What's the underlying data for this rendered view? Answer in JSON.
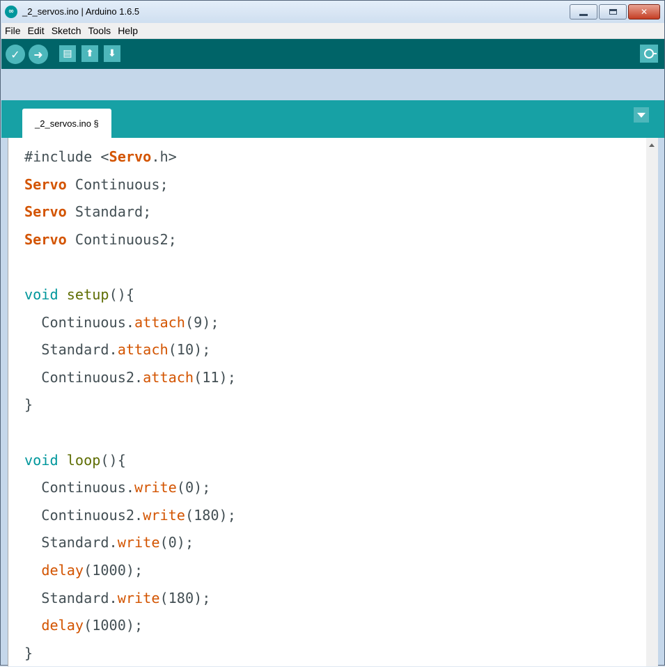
{
  "window": {
    "title": "_2_servos.ino | Arduino 1.6.5",
    "icon": "arduino-logo-icon"
  },
  "menubar": {
    "items": [
      "File",
      "Edit",
      "Sketch",
      "Tools",
      "Help"
    ]
  },
  "toolbar": {
    "buttons": [
      "verify-icon",
      "upload-icon",
      "new-icon",
      "open-icon",
      "save-icon"
    ],
    "serial_monitor_icon": "serial-monitor-icon"
  },
  "tabs": [
    {
      "label": "_2_servos.ino §"
    }
  ],
  "colors": {
    "toolbar_bg": "#006468",
    "tabstrip_bg": "#17a1a5",
    "button_bg": "#4db7bb",
    "keyword_type": "#d35400",
    "keyword_void": "#00979c",
    "function_setup": "#5e6d03",
    "function_call": "#d35400",
    "plain_text": "#434f54"
  },
  "code": {
    "lines": [
      [
        {
          "t": "#include <"
        },
        {
          "t": "Servo",
          "c": "kw-type"
        },
        {
          "t": ".h>"
        }
      ],
      [
        {
          "t": "Servo",
          "c": "kw-type"
        },
        {
          "t": " Continuous;"
        }
      ],
      [
        {
          "t": "Servo",
          "c": "kw-type"
        },
        {
          "t": " Standard;"
        }
      ],
      [
        {
          "t": "Servo",
          "c": "kw-type"
        },
        {
          "t": " Continuous2;"
        }
      ],
      [],
      [
        {
          "t": "void",
          "c": "kw-void"
        },
        {
          "t": " "
        },
        {
          "t": "setup",
          "c": "fn-setup"
        },
        {
          "t": "(){"
        }
      ],
      [
        {
          "t": "  Continuous."
        },
        {
          "t": "attach",
          "c": "fn-call"
        },
        {
          "t": "(9);"
        }
      ],
      [
        {
          "t": "  Standard."
        },
        {
          "t": "attach",
          "c": "fn-call"
        },
        {
          "t": "(10);"
        }
      ],
      [
        {
          "t": "  Continuous2."
        },
        {
          "t": "attach",
          "c": "fn-call"
        },
        {
          "t": "(11);"
        }
      ],
      [
        {
          "t": "}"
        }
      ],
      [],
      [
        {
          "t": "void",
          "c": "kw-void"
        },
        {
          "t": " "
        },
        {
          "t": "loop",
          "c": "fn-setup"
        },
        {
          "t": "(){"
        }
      ],
      [
        {
          "t": "  Continuous."
        },
        {
          "t": "write",
          "c": "fn-call"
        },
        {
          "t": "(0);"
        }
      ],
      [
        {
          "t": "  Continuous2."
        },
        {
          "t": "write",
          "c": "fn-call"
        },
        {
          "t": "(180);"
        }
      ],
      [
        {
          "t": "  Standard."
        },
        {
          "t": "write",
          "c": "fn-call"
        },
        {
          "t": "(0);"
        }
      ],
      [
        {
          "t": "  "
        },
        {
          "t": "delay",
          "c": "fn-call"
        },
        {
          "t": "(1000);"
        }
      ],
      [
        {
          "t": "  Standard."
        },
        {
          "t": "write",
          "c": "fn-call"
        },
        {
          "t": "(180);"
        }
      ],
      [
        {
          "t": "  "
        },
        {
          "t": "delay",
          "c": "fn-call"
        },
        {
          "t": "(1000);"
        }
      ],
      [
        {
          "t": "}"
        }
      ]
    ]
  }
}
